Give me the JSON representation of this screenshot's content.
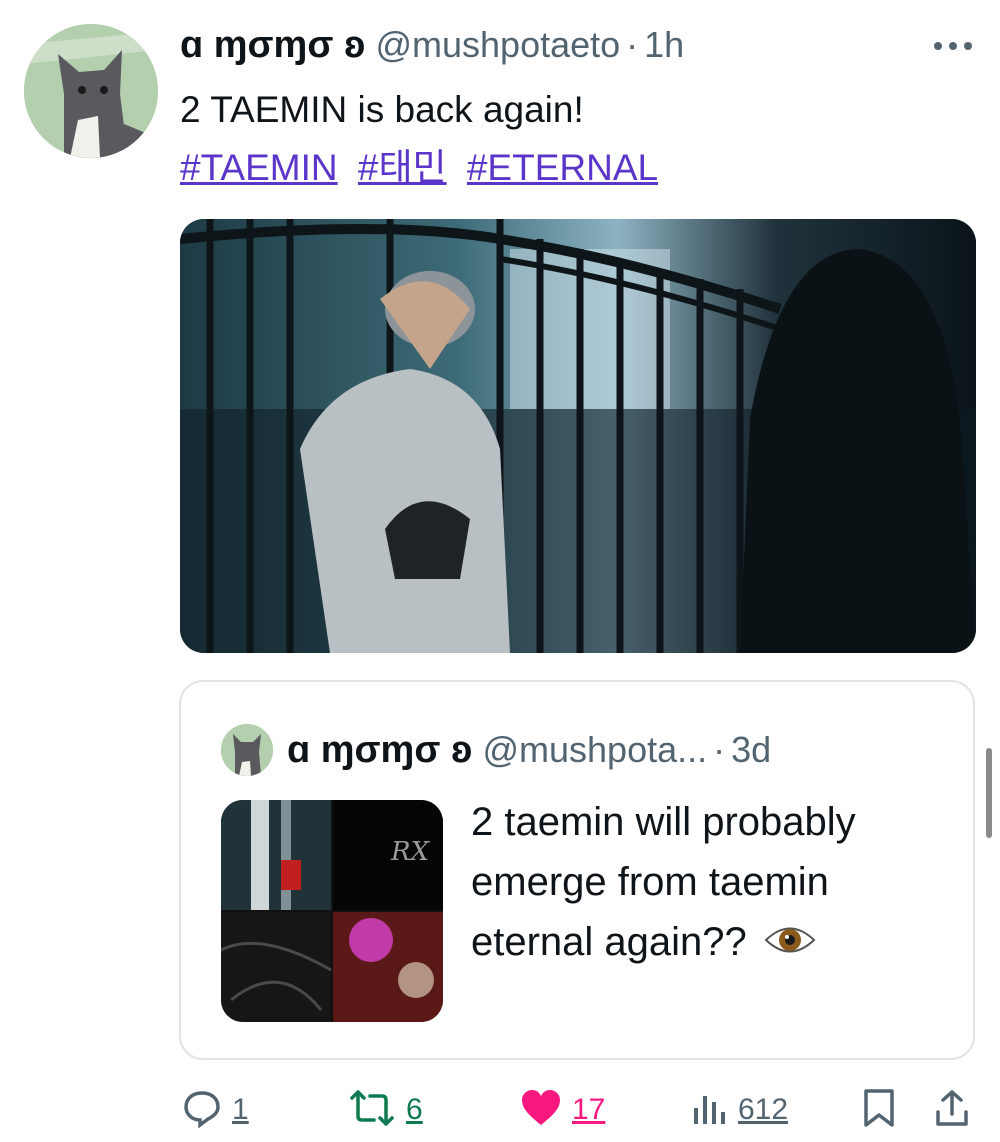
{
  "tweet": {
    "display_name": "ɑ ɱσɱσ ʚ",
    "handle": "@mushpotaeto",
    "separator": "·",
    "time": "1h",
    "text": "2 TAEMIN is back again!",
    "hashtags": [
      "#TAEMIN",
      "#태민",
      "#ETERNAL"
    ],
    "avatar_icon": "cat-avatar-icon",
    "more_icon": "more-icon",
    "media_icon": "video-still-image"
  },
  "quote": {
    "display_name": "ɑ ɱσɱσ ʚ",
    "handle": "@mushpota...",
    "separator": "·",
    "time": "3d",
    "text": "2 taemin will probably emerge from taemin eternal again??",
    "emoji": "eye-emoji",
    "thumb_icon": "collage-thumbnail-image"
  },
  "actions": {
    "reply_count": "1",
    "retweet_count": "6",
    "like_count": "17",
    "views_count": "612",
    "reply_icon": "reply-icon",
    "retweet_icon": "retweet-icon",
    "like_icon": "heart-icon",
    "views_icon": "views-icon",
    "bookmark_icon": "bookmark-icon",
    "share_icon": "share-icon"
  },
  "colors": {
    "text": "#0f1419",
    "muted": "#536471",
    "hashtag": "#5b35c9",
    "retweet": "#0d7a4f",
    "like": "#f91880",
    "border": "#dfe4e8"
  }
}
